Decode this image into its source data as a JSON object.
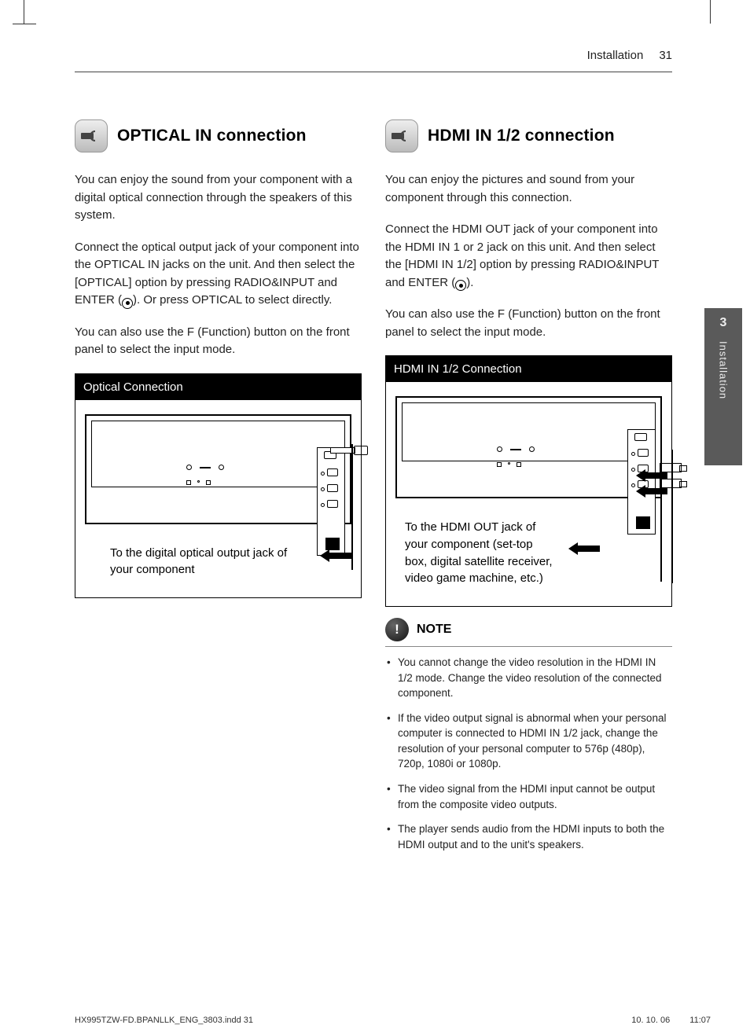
{
  "header": {
    "section": "Installation",
    "page": "31"
  },
  "sideTab": {
    "num": "3",
    "label": "Installation"
  },
  "optical": {
    "title": "OPTICAL IN connection",
    "p1": "You can enjoy the sound from your component with a digital optical connection through the speakers of this system.",
    "p2a": "Connect the optical output jack of your component into the OPTICAL IN jacks on the unit. And then select the [OPTICAL] option by pressing RADIO&INPUT and ENTER (",
    "p2b": "). Or press OPTICAL to select directly.",
    "p3": "You can also use the F (Function) button on the front panel to select the input mode.",
    "figTitle": "Optical Connection",
    "caption": "To the digital optical output jack of your component"
  },
  "hdmi": {
    "title": "HDMI IN 1/2 connection",
    "p1": "You can enjoy the pictures and sound  from your component through this connection.",
    "p2a": "Connect the HDMI OUT jack of your component into the HDMI IN 1 or 2 jack on this unit. And then select the [HDMI IN 1/2] option by pressing RADIO&INPUT and ENTER (",
    "p2b": ").",
    "p3": "You can also use the F (Function) button on the front panel to select the input mode.",
    "figTitle": "HDMI IN 1/2 Connection",
    "caption": "To the HDMI OUT jack of your component (set-top box, digital satellite receiver, video game machine, etc.)"
  },
  "note": {
    "title": "NOTE",
    "items": [
      "You cannot change the video resolution in the HDMI IN 1/2 mode. Change the video resolution of the connected component.",
      "If the video output signal is abnormal when your personal computer is connected to HDMI IN 1/2 jack, change the resolution of your personal computer to 576p (480p), 720p, 1080i or 1080p.",
      "The video signal from the HDMI input cannot be output from the composite video outputs.",
      "The player sends audio from the HDMI inputs to both the HDMI output and to the unit's speakers."
    ]
  },
  "footer": {
    "left": "HX995TZW-FD.BPANLLK_ENG_3803.indd   31",
    "date": "10. 10. 06",
    "time": "11:07"
  }
}
